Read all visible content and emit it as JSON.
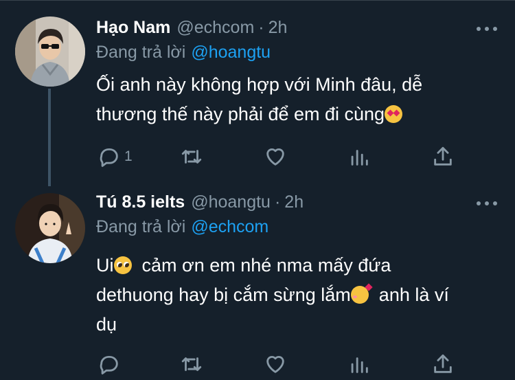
{
  "tweets": [
    {
      "name": "Hạo Nam",
      "handle": "@echcom",
      "dot": "·",
      "time": "2h",
      "reply_label": "Đang trả lời",
      "reply_handle": "@hoangtu",
      "text_lines": [
        "Ối anh này không hợp với Minh đâu, dễ",
        "thương thế này phải để em đi cùng"
      ],
      "emoji": "heart-eyes",
      "reply_count": "1"
    },
    {
      "name": "Tú 8.5 ielts",
      "handle": "@hoangtu",
      "dot": "·",
      "time": "2h",
      "reply_label": "Đang trả lời",
      "reply_handle": "@echcom",
      "text_part1": "Ui",
      "text_part2": "  cảm ơn em nhé nma mấy đứa",
      "text_part3": "dethuong hay bị cắm sừng lắm",
      "text_part4": "  anh là ví",
      "text_part5": "dụ",
      "reply_count": ""
    }
  ],
  "colors": {
    "background": "#15202b",
    "secondary_text": "#8899a6",
    "link": "#1da1f2",
    "thread_line": "#3d5466"
  }
}
